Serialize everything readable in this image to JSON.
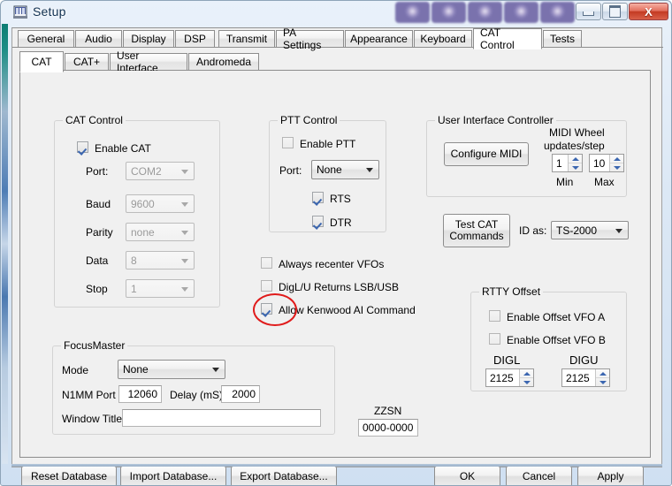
{
  "window": {
    "title": "Setup",
    "icon": "window-setup-icon",
    "buttons": {
      "minimize": "minimize-icon",
      "maximize": "maximize-icon",
      "close": "X"
    },
    "decoration_cells": 5
  },
  "tabs": {
    "main": [
      {
        "label": "General",
        "active": false
      },
      {
        "label": "Audio",
        "active": false
      },
      {
        "label": "Display",
        "active": false
      },
      {
        "label": "DSP",
        "active": false
      },
      {
        "label": "Transmit",
        "active": false
      },
      {
        "label": "PA Settings",
        "active": false
      },
      {
        "label": "Appearance",
        "active": false
      },
      {
        "label": "Keyboard",
        "active": false
      },
      {
        "label": "CAT Control",
        "active": true
      },
      {
        "label": "Tests",
        "active": false
      }
    ],
    "sub": [
      {
        "label": "CAT",
        "active": true
      },
      {
        "label": "CAT+",
        "active": false
      },
      {
        "label": "User Interface",
        "active": false
      },
      {
        "label": "Andromeda",
        "active": false
      }
    ]
  },
  "cat_control": {
    "title": "CAT Control",
    "enable_cat": {
      "label": "Enable CAT",
      "checked": true
    },
    "port": {
      "label": "Port:",
      "value": "COM2",
      "enabled": false
    },
    "baud": {
      "label": "Baud",
      "value": "9600",
      "enabled": false
    },
    "parity": {
      "label": "Parity",
      "value": "none",
      "enabled": false
    },
    "data": {
      "label": "Data",
      "value": "8",
      "enabled": false
    },
    "stop": {
      "label": "Stop",
      "value": "1",
      "enabled": false
    }
  },
  "ptt_control": {
    "title": "PTT Control",
    "enable_ptt": {
      "label": "Enable PTT",
      "checked": false
    },
    "port": {
      "label": "Port:",
      "value": "None"
    },
    "rts": {
      "label": "RTS",
      "checked": true
    },
    "dtr": {
      "label": "DTR",
      "checked": true
    }
  },
  "options": [
    {
      "label": "Always recenter VFOs",
      "checked": false
    },
    {
      "label": "DigL/U Returns LSB/USB",
      "checked": false
    },
    {
      "label": "Allow Kenwood AI Command",
      "checked": true,
      "annotated": true
    }
  ],
  "uic": {
    "title": "User Interface Controller",
    "configure_midi": "Configure MIDI",
    "midi_wheel": {
      "title_line1": "MIDI Wheel",
      "title_line2": "updates/step",
      "min": {
        "value": "1",
        "label": "Min"
      },
      "max": {
        "value": "10",
        "label": "Max"
      }
    }
  },
  "test_cat": {
    "button_line1": "Test CAT",
    "button_line2": "Commands",
    "id_as_label": "ID as:",
    "id_as_value": "TS-2000"
  },
  "rtty_offset": {
    "title": "RTTY Offset",
    "enable_vfo_a": {
      "label": "Enable Offset VFO A",
      "checked": false
    },
    "enable_vfo_b": {
      "label": "Enable Offset VFO B",
      "checked": false
    },
    "digl": {
      "label": "DIGL",
      "value": "2125"
    },
    "digu": {
      "label": "DIGU",
      "value": "2125"
    }
  },
  "focusmaster": {
    "title": "FocusMaster",
    "mode": {
      "label": "Mode",
      "value": "None"
    },
    "n1mm_port": {
      "label": "N1MM Port",
      "value": "12060"
    },
    "delay": {
      "label": "Delay (mS)",
      "value": "2000"
    },
    "window_title": {
      "label": "Window Title",
      "value": ""
    }
  },
  "zzsn": {
    "label": "ZZSN",
    "value": "0000-0000"
  },
  "footer": {
    "reset_database": "Reset Database",
    "import_database": "Import Database...",
    "export_database": "Export Database...",
    "ok": "OK",
    "cancel": "Cancel",
    "apply": "Apply"
  },
  "colors": {
    "accent_red": "#e01b1b",
    "checkmark_blue": "#3b66b0",
    "background": "#f0f0f0"
  }
}
